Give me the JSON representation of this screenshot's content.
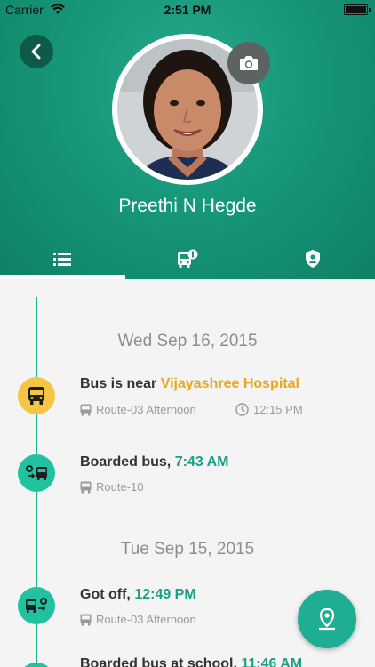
{
  "status_bar": {
    "carrier": "Carrier",
    "time": "2:51 PM"
  },
  "profile": {
    "name": "Preethi N Hegde"
  },
  "tabs": [
    {
      "icon": "list-icon"
    },
    {
      "icon": "bus-info-icon"
    },
    {
      "icon": "shield-user-icon"
    }
  ],
  "timeline": [
    {
      "date": "Wed Sep 16, 2015"
    },
    {
      "event": {
        "prefix": "Bus is near ",
        "highlight": "Vijayashree Hospital",
        "route": "Route-03 Afternoon",
        "time": "12:15 PM"
      }
    },
    {
      "event": {
        "prefix": "Boarded bus, ",
        "highlight": "7:43 AM",
        "route": "Route-10"
      }
    },
    {
      "date": "Tue Sep 15, 2015"
    },
    {
      "event": {
        "prefix": "Got off, ",
        "highlight": "12:49 PM",
        "route": "Route-03 Afternoon"
      }
    },
    {
      "event": {
        "prefix": "Boarded bus at school, ",
        "highlight": "11:46 AM"
      }
    }
  ],
  "colors": {
    "header": "#17977a",
    "accent": "#1fae91",
    "yellow": "#f6c544",
    "highlight_yellow": "#e9a719"
  }
}
